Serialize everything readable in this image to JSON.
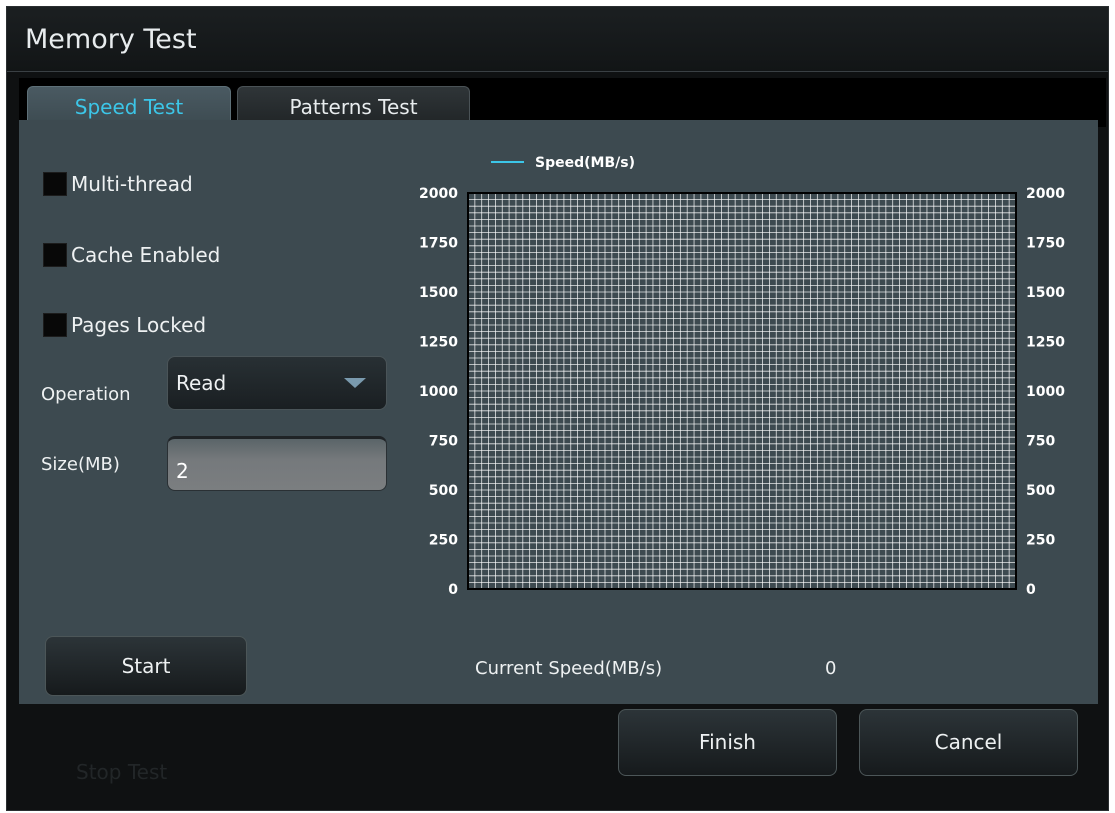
{
  "window": {
    "title": "Memory Test"
  },
  "tabs": [
    {
      "label": "Speed Test",
      "active": true
    },
    {
      "label": "Patterns Test",
      "active": false
    }
  ],
  "options": {
    "multi_thread": {
      "label": "Multi-thread",
      "checked": false
    },
    "cache_enabled": {
      "label": "Cache Enabled",
      "checked": false
    },
    "pages_locked": {
      "label": "Pages Locked",
      "checked": false
    }
  },
  "operation": {
    "label": "Operation",
    "value": "Read"
  },
  "size": {
    "label": "Size(MB)",
    "value": "2"
  },
  "start_button": {
    "label": "Start"
  },
  "current_speed": {
    "label": "Current Speed(MB/s)",
    "value": "0"
  },
  "footer": {
    "finish_label": "Finish",
    "cancel_label": "Cancel",
    "stop_test_label": "Stop Test"
  },
  "colors": {
    "accent": "#3cc6e8",
    "panel": "#3d4a50",
    "grid": "#ffffff"
  },
  "chart_data": {
    "type": "line",
    "legend": "Speed(MB/s)",
    "series": [
      {
        "name": "Speed(MB/s)",
        "x": [],
        "y": []
      }
    ],
    "ylim": [
      0,
      2000
    ],
    "yticks": [
      "0",
      "250",
      "500",
      "750",
      "1000",
      "1250",
      "1500",
      "1750",
      "2000"
    ],
    "y2ticks": [
      "0",
      "250",
      "500",
      "750",
      "1000",
      "1250",
      "1500",
      "1750",
      "2000"
    ],
    "grid": true,
    "legend_position": "top"
  }
}
